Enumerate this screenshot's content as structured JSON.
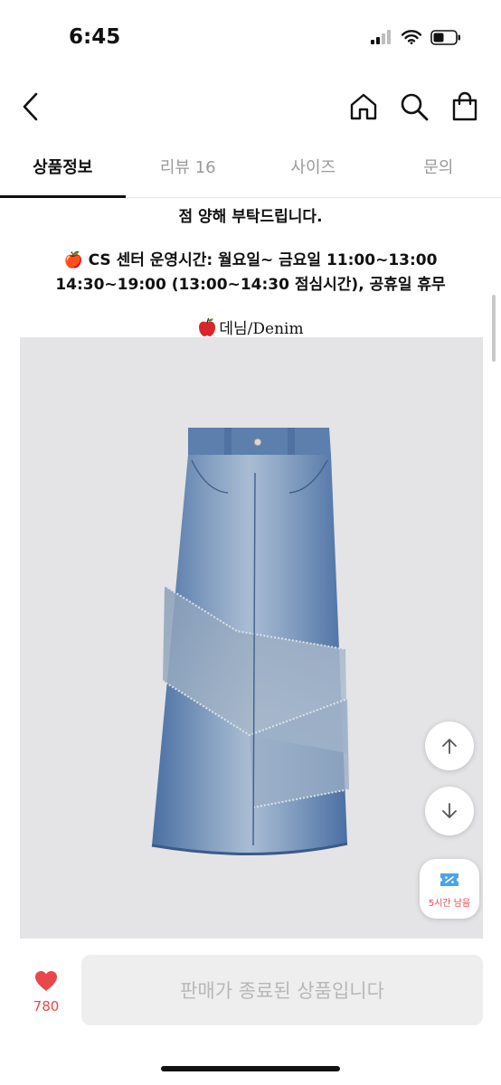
{
  "status_bar": {
    "time": "6:45",
    "icons": [
      "signal-icon",
      "wifi-icon",
      "battery-icon"
    ]
  },
  "nav": {
    "back_icon": "chevron-left-icon",
    "home_icon": "home-icon",
    "search_icon": "search-icon",
    "cart_icon": "shopping-bag-icon"
  },
  "tabs": [
    {
      "label": "상품정보",
      "active": true
    },
    {
      "label": "리뷰 16",
      "active": false
    },
    {
      "label": "사이즈",
      "active": false
    },
    {
      "label": "문의",
      "active": false
    }
  ],
  "content": {
    "notice_line1": "점 양해 부탁드립니다.",
    "cs_line1": "🍎 CS 센터 운영시간: 월요일~ 금요일 11:00~13:00",
    "cs_line2": "14:30~19:00 (13:00~14:30 점심시간), 공휴일 휴무",
    "fabric_icon": "apple-icon",
    "fabric_label": "데님/Denim"
  },
  "floating": {
    "scroll_up_icon": "arrow-up-icon",
    "scroll_down_icon": "arrow-down-icon",
    "coupon_icon": "coupon-icon",
    "coupon_text": "5시간 남음"
  },
  "bottom": {
    "like_icon": "heart-icon",
    "like_count": "780",
    "sold_label": "판매가 종료된 상품입니다"
  },
  "colors": {
    "accent_red": "#e8474b",
    "tab_active": "#111111",
    "tab_inactive": "#9a9a9a",
    "disabled_button_bg": "#eeeeee",
    "disabled_button_text": "#b7b7b7",
    "image_bg": "#e4e3e5"
  }
}
